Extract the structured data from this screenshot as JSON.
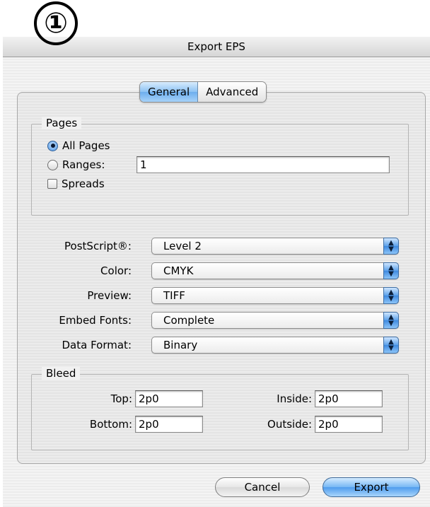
{
  "step_badge": "①",
  "dialog": {
    "title": "Export EPS",
    "tabs": [
      {
        "label": "General",
        "active": true
      },
      {
        "label": "Advanced",
        "active": false
      }
    ],
    "pages": {
      "group_label": "Pages",
      "all_pages_label": "All Pages",
      "all_pages_selected": true,
      "ranges_label": "Ranges:",
      "ranges_value": "1",
      "spreads_label": "Spreads",
      "spreads_checked": false
    },
    "settings": [
      {
        "label": "PostScript®:",
        "value": "Level 2"
      },
      {
        "label": "Color:",
        "value": "CMYK"
      },
      {
        "label": "Preview:",
        "value": "TIFF"
      },
      {
        "label": "Embed Fonts:",
        "value": "Complete"
      },
      {
        "label": "Data Format:",
        "value": "Binary"
      }
    ],
    "bleed": {
      "group_label": "Bleed",
      "top_label": "Top:",
      "top_value": "2p0",
      "bottom_label": "Bottom:",
      "bottom_value": "2p0",
      "inside_label": "Inside:",
      "inside_value": "2p0",
      "outside_label": "Outside:",
      "outside_value": "2p0"
    },
    "buttons": {
      "cancel": "Cancel",
      "export": "Export"
    }
  },
  "colors": {
    "accent_blue": "#6daeee",
    "titlebar": "#e2e2e2"
  }
}
